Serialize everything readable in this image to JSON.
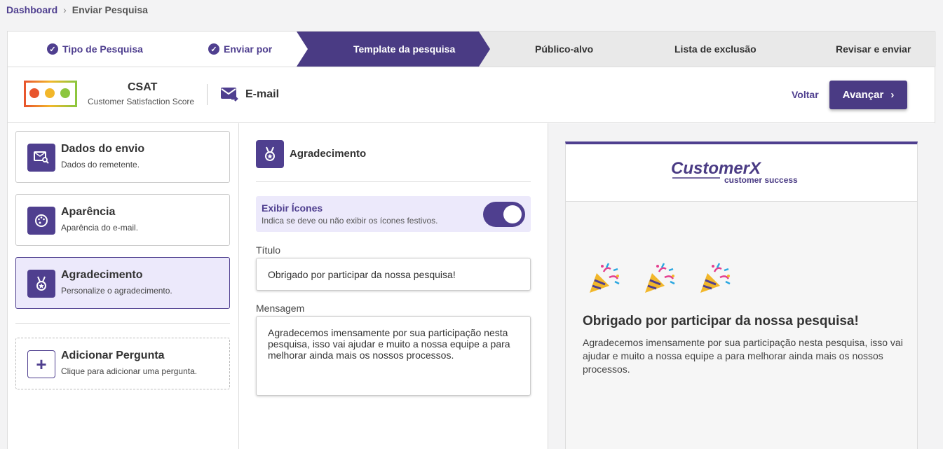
{
  "breadcrumb": {
    "home": "Dashboard",
    "separator": "›",
    "current": "Enviar Pesquisa"
  },
  "stepper": {
    "steps": [
      {
        "label": "Tipo de Pesquisa",
        "state": "done"
      },
      {
        "label": "Enviar por",
        "state": "done"
      },
      {
        "label": "Template da pesquisa",
        "state": "active"
      },
      {
        "label": "Público-alvo",
        "state": "pending"
      },
      {
        "label": "Lista de exclusão",
        "state": "pending"
      },
      {
        "label": "Revisar e enviar",
        "state": "pending"
      }
    ],
    "check_glyph": "✓"
  },
  "header": {
    "survey_type": "CSAT",
    "survey_type_desc": "Customer Satisfaction Score",
    "channel": "E-mail",
    "back_label": "Voltar",
    "next_label": "Avançar",
    "next_glyph": "›"
  },
  "sidebar": {
    "items": [
      {
        "title": "Dados do envio",
        "subtitle": "Dados do remetente.",
        "icon": "mail-search-icon"
      },
      {
        "title": "Aparência",
        "subtitle": "Aparência do e-mail.",
        "icon": "palette-icon"
      },
      {
        "title": "Agradecimento",
        "subtitle": "Personalize o agradecimento.",
        "icon": "medal-icon",
        "active": true
      }
    ],
    "add": {
      "title": "Adicionar Pergunta",
      "subtitle": "Clique para adicionar uma pergunta.",
      "icon": "plus-icon",
      "glyph": "+"
    }
  },
  "editor": {
    "title": "Agradecimento",
    "toggle": {
      "label": "Exibir Ícones",
      "description": "Indica se deve ou não exibir os ícones festivos.",
      "on": true
    },
    "title_field": {
      "label": "Título",
      "value": "Obrigado por participar da nossa pesquisa!"
    },
    "message_field": {
      "label": "Mensagem",
      "value": "Agradecemos imensamente por sua participação nesta pesquisa, isso vai ajudar e muito a nossa equipe a para melhorar ainda mais os nossos processos."
    }
  },
  "preview": {
    "brand_name": "CustomerX",
    "brand_tagline": "customer success",
    "title": "Obrigado por participar da nossa pesquisa!",
    "message": "Agradecemos imensamente por sua participação nesta pesquisa, isso vai ajudar e muito a nossa equipe a para melhorar ainda mais os nossos processos."
  },
  "colors": {
    "accent": "#4f3f8f",
    "active_bg": "#ece9fb"
  }
}
